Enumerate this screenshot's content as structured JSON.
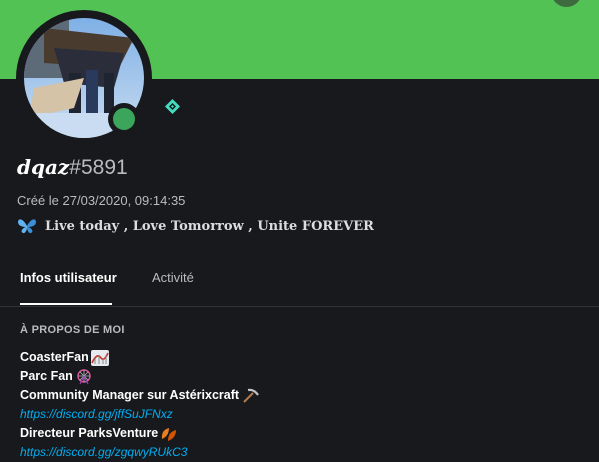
{
  "user": {
    "name": "dqaz",
    "discriminator": "#5891",
    "created": "Créé le 27/03/2020, 09:14:35",
    "custom_status": "Live today , Love Tomorrow , Unite FOREVER",
    "status": "online"
  },
  "tabs": [
    {
      "label": "Infos utilisateur",
      "active": true
    },
    {
      "label": "Activité",
      "active": false
    }
  ],
  "about": {
    "title": "À PROPOS DE MOI",
    "lines": [
      {
        "text": "CoasterFan",
        "emoji": "roller-coaster"
      },
      {
        "text": "Parc Fan",
        "emoji": "ferris-wheel"
      },
      {
        "text": "Community Manager sur Astérixcraft",
        "emoji": "pick"
      },
      {
        "link": "https://discord.gg/jffSuJFNxz"
      },
      {
        "text": "Directeur ParksVenture",
        "emoji": "leaves"
      },
      {
        "link": "https://discord.gg/zgqwyRUkC3"
      }
    ]
  },
  "colors": {
    "banner": "#53c255",
    "background": "#18191c",
    "online": "#3ba55c",
    "link": "#00aff4"
  }
}
